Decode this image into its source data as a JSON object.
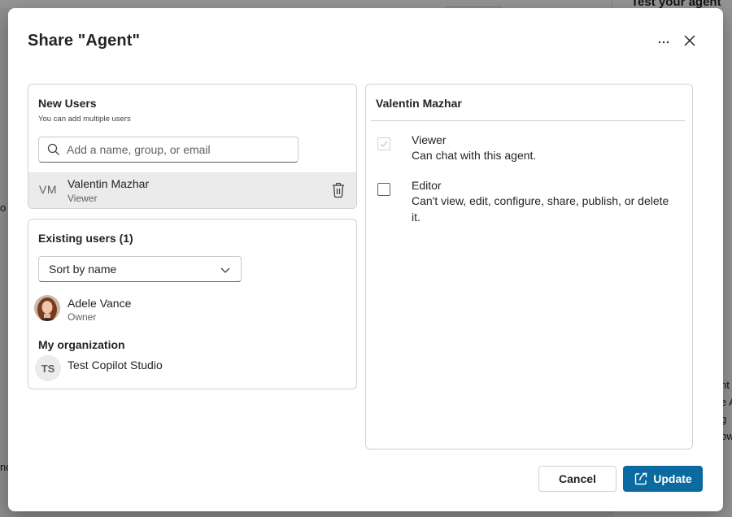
{
  "background": {
    "right_title": "Test your agent",
    "right_fragments": [
      "nt",
      "e A",
      "g",
      "ow"
    ],
    "left_fragments": [
      "o",
      "no"
    ]
  },
  "dialog": {
    "title": "Share \"Agent\"",
    "more_icon": "more-horizontal-icon",
    "close_icon": "close-icon"
  },
  "new_users": {
    "title": "New Users",
    "subtitle": "You can add multiple users",
    "search_placeholder": "Add a name, group, or email",
    "search_icon": "search-icon",
    "pending_user": {
      "initials": "VM",
      "name": "Valentin Mazhar",
      "role": "Viewer",
      "delete_icon": "trash-icon"
    }
  },
  "existing_users": {
    "title": "Existing users (1)",
    "sort_label": "Sort by name",
    "sort_icon": "chevron-down-icon",
    "users": [
      {
        "name": "Adele Vance",
        "role": "Owner",
        "avatar": "photo"
      }
    ],
    "org_title": "My organization",
    "org": {
      "initials": "TS",
      "name": "Test Copilot Studio"
    }
  },
  "permissions": {
    "user_name": "Valentin Mazhar",
    "options": [
      {
        "name": "Viewer",
        "description": "Can chat with this agent.",
        "checked": true,
        "disabled": true
      },
      {
        "name": "Editor",
        "description": "Can't view, edit, configure, share, publish, or delete it.",
        "checked": false,
        "disabled": false
      }
    ]
  },
  "footer": {
    "cancel_label": "Cancel",
    "update_label": "Update",
    "update_icon": "share-icon"
  },
  "colors": {
    "primary": "#0b6a9f",
    "selected_row": "#ebebeb",
    "border": "#d1d1d1"
  }
}
